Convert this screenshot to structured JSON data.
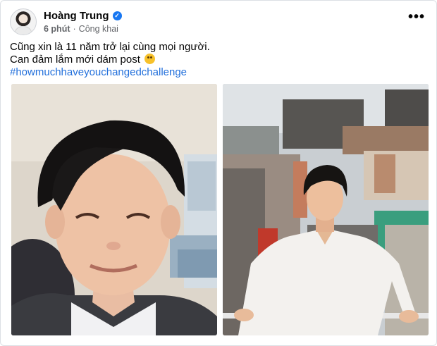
{
  "post": {
    "author": {
      "name": "Hoàng Trung",
      "verified_icon": "verified-badge-icon",
      "avatar_icon": "profile-avatar"
    },
    "time": "6 phút",
    "separator": "·",
    "audience": "Công khai",
    "more_label": "•••",
    "text_lines": [
      "Cũng xin là 11 năm trở lại cùng mọi người.",
      "Can đảm lắm mới dám post"
    ],
    "emoji": "upside-down-face-emoji",
    "hashtag": "#howmuchhaveyouchangedchallenge",
    "photos": [
      {
        "icon": "then-photo",
        "alt": ""
      },
      {
        "icon": "now-photo",
        "alt": ""
      }
    ]
  },
  "colors": {
    "accent": "#1877f2",
    "hashtag": "#216fdb",
    "secondary_text": "#65676b"
  }
}
